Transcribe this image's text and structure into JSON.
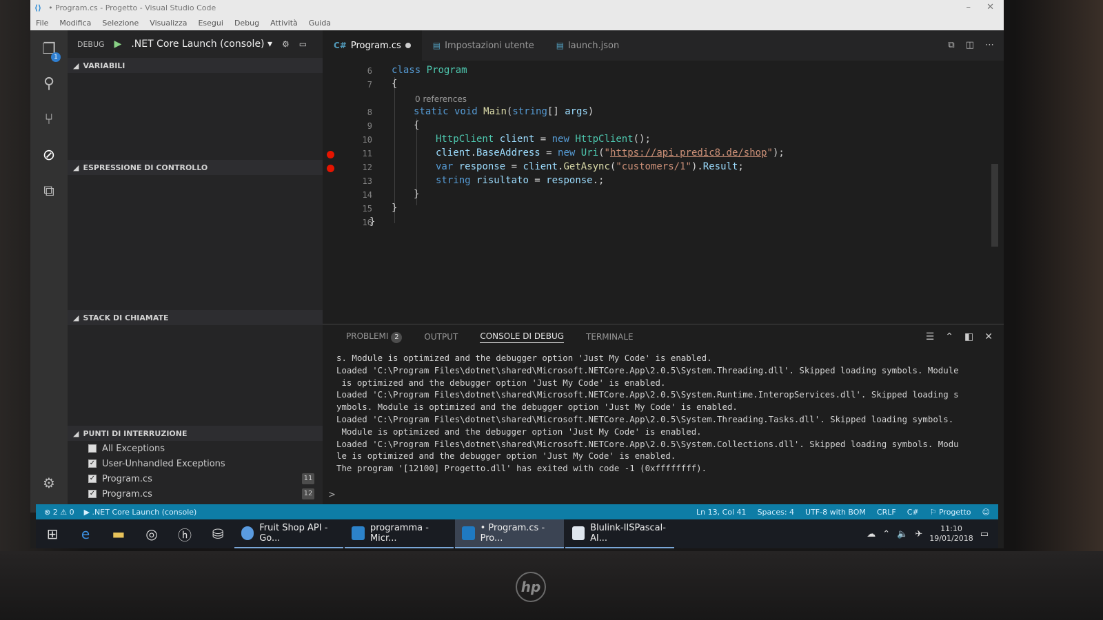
{
  "window": {
    "title": "• Program.cs - Progetto - Visual Studio Code"
  },
  "menu": [
    "File",
    "Modifica",
    "Selezione",
    "Visualizza",
    "Esegui",
    "Debug",
    "Attività",
    "Guida"
  ],
  "activity_bar": {
    "explorer_badge": "1",
    "icons": [
      "files-icon",
      "search-icon",
      "source-control-icon",
      "debug-icon",
      "extensions-icon",
      "gear-icon"
    ]
  },
  "sidebar": {
    "debug_label": "DEBUG",
    "launch_config": ".NET Core Launch (console)",
    "sections": {
      "variables": "VARIABILI",
      "watch": "ESPRESSIONE DI CONTROLLO",
      "call_stack": "STACK DI CHIAMATE",
      "breakpoints": "PUNTI DI INTERRUZIONE"
    },
    "breakpoints": [
      {
        "label": "All Exceptions",
        "checked": false,
        "line": ""
      },
      {
        "label": "User-Unhandled Exceptions",
        "checked": true,
        "line": ""
      },
      {
        "label": "Program.cs",
        "checked": true,
        "line": "11"
      },
      {
        "label": "Program.cs",
        "checked": true,
        "line": "12"
      }
    ]
  },
  "tabs": [
    {
      "label": "Program.cs",
      "active": true,
      "modified": true
    },
    {
      "label": "Impostazioni utente",
      "active": false,
      "modified": false
    },
    {
      "label": "launch.json",
      "active": false,
      "modified": false
    }
  ],
  "editor": {
    "references_hint": "0 references",
    "breakpoint_lines": [
      11,
      12
    ],
    "lines": [
      {
        "n": "6",
        "text": "class Program"
      },
      {
        "n": "7",
        "text": "{"
      },
      {
        "n": "8",
        "text": "static void Main(string[] args)"
      },
      {
        "n": "9",
        "text": "{"
      },
      {
        "n": "10",
        "text": "HttpClient client = new HttpClient();"
      },
      {
        "n": "11",
        "text": "client.BaseAddress = new Uri(\"https://api.predic8.de/shop\");"
      },
      {
        "n": "12",
        "text": "var response = client.GetAsync(\"customers/1\").Result;"
      },
      {
        "n": "13",
        "text": "string risultato = response.;"
      },
      {
        "n": "14",
        "text": "}"
      },
      {
        "n": "15",
        "text": "}"
      },
      {
        "n": "16",
        "text": "}"
      }
    ]
  },
  "panel": {
    "tabs": [
      {
        "label": "PROBLEMI",
        "count": "2"
      },
      {
        "label": "OUTPUT"
      },
      {
        "label": "CONSOLE DI DEBUG",
        "active": true
      },
      {
        "label": "TERMINALE"
      }
    ],
    "console_lines": [
      "s. Module is optimized and the debugger option 'Just My Code' is enabled.",
      "Loaded 'C:\\Program Files\\dotnet\\shared\\Microsoft.NETCore.App\\2.0.5\\System.Threading.dll'. Skipped loading symbols. Module",
      " is optimized and the debugger option 'Just My Code' is enabled.",
      "Loaded 'C:\\Program Files\\dotnet\\shared\\Microsoft.NETCore.App\\2.0.5\\System.Runtime.InteropServices.dll'. Skipped loading s",
      "ymbols. Module is optimized and the debugger option 'Just My Code' is enabled.",
      "Loaded 'C:\\Program Files\\dotnet\\shared\\Microsoft.NETCore.App\\2.0.5\\System.Threading.Tasks.dll'. Skipped loading symbols.",
      " Module is optimized and the debugger option 'Just My Code' is enabled.",
      "Loaded 'C:\\Program Files\\dotnet\\shared\\Microsoft.NETCore.App\\2.0.5\\System.Collections.dll'. Skipped loading symbols. Modu",
      "le is optimized and the debugger option 'Just My Code' is enabled.",
      "The program '[12100] Progetto.dll' has exited with code -1 (0xffffffff)."
    ],
    "prompt": ">"
  },
  "statusbar": {
    "errors": "2",
    "warnings": "0",
    "launch": ".NET Core Launch (console)",
    "position": "Ln 13, Col 41",
    "spaces": "Spaces: 4",
    "encoding": "UTF-8 with BOM",
    "eol": "CRLF",
    "language": "C#",
    "project": "Progetto"
  },
  "taskbar": {
    "apps": [
      {
        "label": "Fruit Shop API - Go...",
        "active": false
      },
      {
        "label": "programma - Micr...",
        "active": false
      },
      {
        "label": "• Program.cs - Pro...",
        "active": true
      },
      {
        "label": "Blulink-IISPascal-Al...",
        "active": false
      }
    ],
    "time": "11:10",
    "date": "19/01/2018"
  },
  "bezel": {
    "logo": "hp"
  }
}
